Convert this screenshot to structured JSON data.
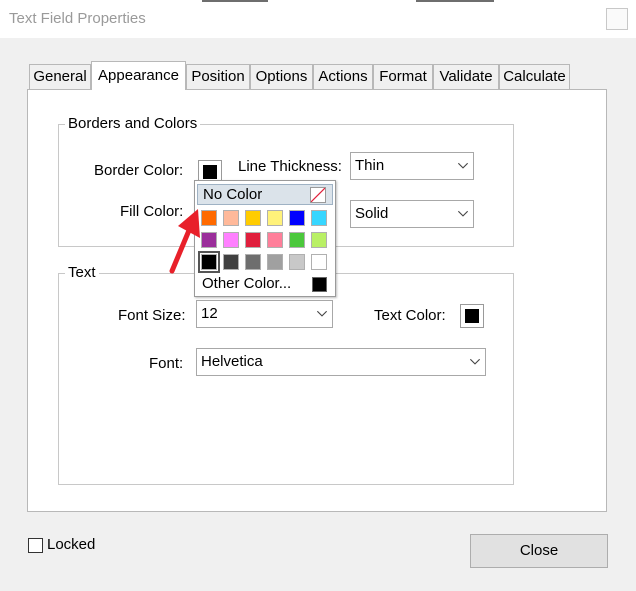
{
  "window": {
    "title": "Text Field Properties"
  },
  "tabs": [
    {
      "label": "General"
    },
    {
      "label": "Appearance"
    },
    {
      "label": "Position"
    },
    {
      "label": "Options"
    },
    {
      "label": "Actions"
    },
    {
      "label": "Format"
    },
    {
      "label": "Validate"
    },
    {
      "label": "Calculate"
    }
  ],
  "active_tab": "Appearance",
  "borders_colors": {
    "legend": "Borders and Colors",
    "border_color_label": "Border Color:",
    "fill_color_label": "Fill Color:",
    "line_thickness_label": "Line Thickness:",
    "line_thickness_value": "Thin",
    "line_style_value": "Solid",
    "border_color": "#000000"
  },
  "color_popup": {
    "no_color_label": "No Color",
    "other_color_label": "Other Color...",
    "rows": [
      [
        "#ff6a00",
        "#ffb99a",
        "#ffcc00",
        "#fff27a",
        "#0000ff",
        "#37d6ff"
      ],
      [
        "#9b2f9b",
        "#ff80ff",
        "#e01f3d",
        "#ff7f9a",
        "#4bc83c",
        "#b9f065"
      ],
      [
        "#000000",
        "#404040",
        "#6e6e6e",
        "#a0a0a0",
        "#c8c8c8",
        "#ffffff"
      ]
    ],
    "selected": "#000000",
    "other_color": "#000000"
  },
  "text": {
    "legend": "Text",
    "font_size_label": "Font Size:",
    "font_size_value": "12",
    "text_color_label": "Text Color:",
    "text_color": "#000000",
    "font_label": "Font:",
    "font_value": "Helvetica"
  },
  "footer": {
    "locked_label": "Locked",
    "locked_checked": false,
    "close_label": "Close"
  },
  "annotation_arrow_color": "#e8202a"
}
